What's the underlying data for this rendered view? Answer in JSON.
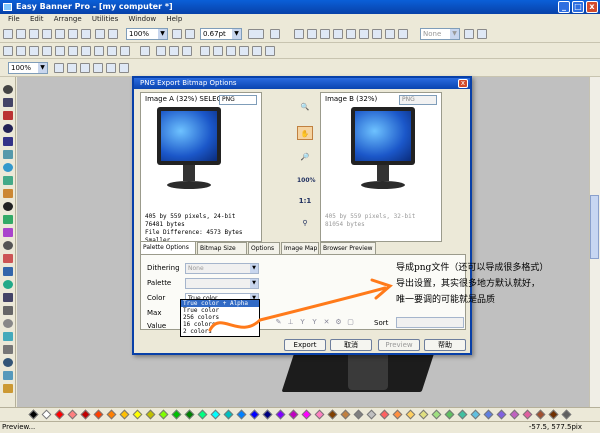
{
  "app": {
    "title": "Easy Banner Pro - [my computer *]",
    "menu": [
      "File",
      "Edit",
      "Arrange",
      "Utilities",
      "Window",
      "Help"
    ]
  },
  "toolbar": {
    "zoom1": "100%",
    "stroke_width": "0.67pt",
    "line_style": "None",
    "zoom2": "100%"
  },
  "dialog": {
    "title": "PNG Export Bitmap Options",
    "close": "x",
    "pane_a": {
      "label": "Image A (32%) SELECTED",
      "format": "PNG",
      "info": [
        "405 by 559 pixels, 24-bit",
        "76481 bytes",
        "File Difference: 4573 Bytes Smaller"
      ]
    },
    "pane_b": {
      "label": "Image B (32%)",
      "format": "PNG",
      "info": [
        "405 by 559 pixels, 32-bit",
        "81054 bytes"
      ]
    },
    "tools": [
      "100%",
      "1:1"
    ],
    "tabs": [
      "Palette Options",
      "Bitmap Size",
      "Options",
      "Image Map",
      "Browser Preview"
    ],
    "fields": {
      "dithering_label": "Dithering",
      "dithering_value": "None",
      "palette_label": "Palette",
      "color_label": "Color",
      "color_value": "True color",
      "max_label": "Max",
      "value_label": "Value",
      "sort_label": "Sort"
    },
    "color_options": [
      "True color + Alpha",
      "True color",
      "256 colors",
      "16 colors",
      "2 colors"
    ],
    "buttons": {
      "export": "Export",
      "cancel": "取消",
      "preview": "Preview",
      "help": "帮助"
    }
  },
  "annotation": [
    "导成png文件（还可以导成很多格式）",
    "导出设置，其实很多地方默认就好，",
    "唯一要调的可能就是品质"
  ],
  "status": {
    "left": "Preview...",
    "coords": "-57.5, 577.5pix"
  }
}
